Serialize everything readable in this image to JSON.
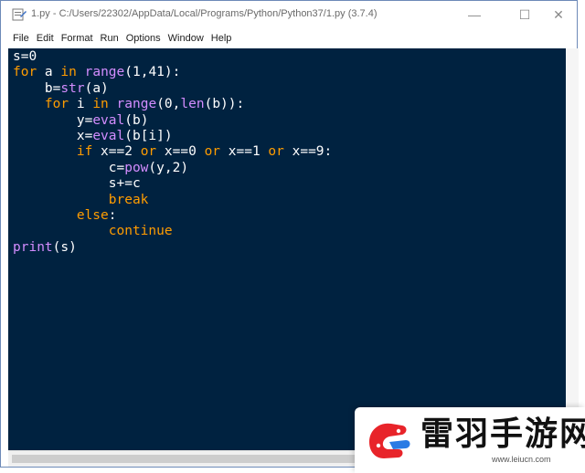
{
  "window": {
    "title": "1.py - C:/Users/22302/AppData/Local/Programs/Python/Python37/1.py (3.7.4)",
    "minimize_glyph": "—",
    "maximize_glyph": "☐",
    "close_glyph": "✕"
  },
  "menu": [
    "File",
    "Edit",
    "Format",
    "Run",
    "Options",
    "Window",
    "Help"
  ],
  "colors": {
    "editor_bg": "#002240",
    "keyword": "#ff9d00",
    "builtin": "#d48dff",
    "text": "#ffffff"
  },
  "code_lines": [
    [
      {
        "t": "s=0",
        "c": "n"
      }
    ],
    [
      {
        "t": "for",
        "c": "kw"
      },
      {
        "t": " a ",
        "c": "n"
      },
      {
        "t": "in",
        "c": "kw"
      },
      {
        "t": " ",
        "c": "n"
      },
      {
        "t": "range",
        "c": "bi"
      },
      {
        "t": "(1,41):",
        "c": "n"
      }
    ],
    [
      {
        "t": "    b=",
        "c": "n"
      },
      {
        "t": "str",
        "c": "bi"
      },
      {
        "t": "(a)",
        "c": "n"
      }
    ],
    [
      {
        "t": "    ",
        "c": "n"
      },
      {
        "t": "for",
        "c": "kw"
      },
      {
        "t": " i ",
        "c": "n"
      },
      {
        "t": "in",
        "c": "kw"
      },
      {
        "t": " ",
        "c": "n"
      },
      {
        "t": "range",
        "c": "bi"
      },
      {
        "t": "(0,",
        "c": "n"
      },
      {
        "t": "len",
        "c": "bi"
      },
      {
        "t": "(b)):",
        "c": "n"
      }
    ],
    [
      {
        "t": "        y=",
        "c": "n"
      },
      {
        "t": "eval",
        "c": "bi"
      },
      {
        "t": "(b)",
        "c": "n"
      }
    ],
    [
      {
        "t": "        x=",
        "c": "n"
      },
      {
        "t": "eval",
        "c": "bi"
      },
      {
        "t": "(b[i])",
        "c": "n"
      }
    ],
    [
      {
        "t": "        ",
        "c": "n"
      },
      {
        "t": "if",
        "c": "kw"
      },
      {
        "t": " x==2 ",
        "c": "n"
      },
      {
        "t": "or",
        "c": "kw"
      },
      {
        "t": " x==0 ",
        "c": "n"
      },
      {
        "t": "or",
        "c": "kw"
      },
      {
        "t": " x==1 ",
        "c": "n"
      },
      {
        "t": "or",
        "c": "kw"
      },
      {
        "t": " x==9:",
        "c": "n"
      }
    ],
    [
      {
        "t": "            c=",
        "c": "n"
      },
      {
        "t": "pow",
        "c": "bi"
      },
      {
        "t": "(y,2)",
        "c": "n"
      }
    ],
    [
      {
        "t": "            s+=c",
        "c": "n"
      }
    ],
    [
      {
        "t": "            ",
        "c": "n"
      },
      {
        "t": "break",
        "c": "kw"
      }
    ],
    [
      {
        "t": "        ",
        "c": "n"
      },
      {
        "t": "else",
        "c": "kw"
      },
      {
        "t": ":",
        "c": "n"
      }
    ],
    [
      {
        "t": "            ",
        "c": "n"
      },
      {
        "t": "continue",
        "c": "kw"
      }
    ],
    [
      {
        "t": "print",
        "c": "bi"
      },
      {
        "t": "(s)",
        "c": "n"
      }
    ]
  ],
  "watermark": {
    "title": "雷羽手游网",
    "url": "www.leiucn.com"
  }
}
